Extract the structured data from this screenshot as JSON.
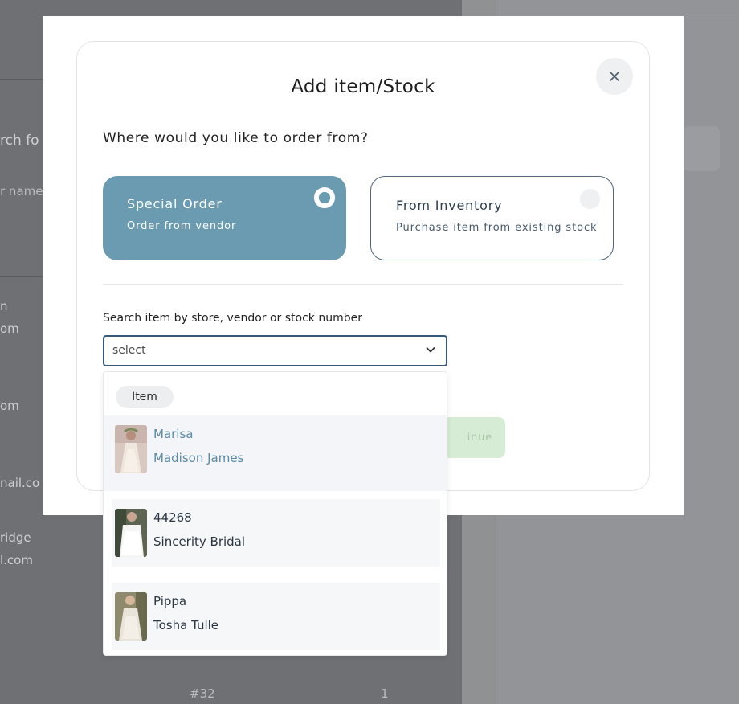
{
  "background": {
    "left_texts": [
      "rch fo",
      "r name",
      "n",
      "om",
      "om",
      "nail.co",
      "ridge",
      "l.com"
    ],
    "bottom_texts": [
      "#32",
      "1"
    ]
  },
  "modal": {
    "title": "Add item/Stock",
    "question": "Where would you like to order from?",
    "options": [
      {
        "title": "Special Order",
        "subtitle": "Order from vendor",
        "selected": true
      },
      {
        "title": "From Inventory",
        "subtitle": "Purchase item from existing stock",
        "selected": false
      }
    ],
    "search_label": "Search item by store, vendor or stock number",
    "search_placeholder": "select",
    "continue_label": "inue",
    "close_icon": "close-icon",
    "dropdown": {
      "group_label": "Item",
      "items": [
        {
          "name": "Marisa",
          "vendor": "Madison James",
          "highlighted": true
        },
        {
          "name": "44268",
          "vendor": "Sincerity Bridal",
          "highlighted": false
        },
        {
          "name": "Pippa",
          "vendor": "Tosha Tulle",
          "highlighted": false
        }
      ]
    }
  },
  "colors": {
    "accent": "#6b9bb0",
    "border_dark": "#35597a",
    "continue_bg": "#d7ecd5",
    "overlay": "#6e7074"
  }
}
